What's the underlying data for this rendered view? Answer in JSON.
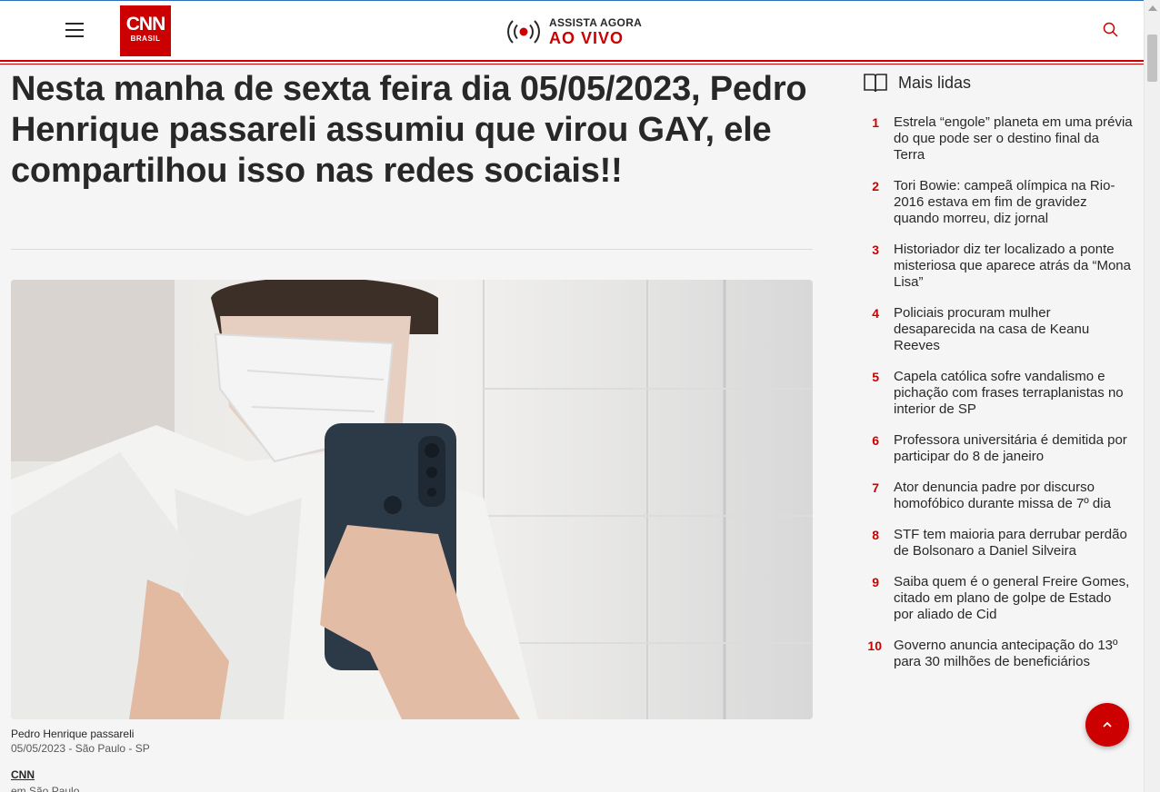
{
  "header": {
    "menu_icon": "hamburger-menu-icon",
    "logo": {
      "brand": "CNN",
      "sub": "BRASIL"
    },
    "live": {
      "top": "ASSISTA AGORA",
      "bottom": "AO VIVO",
      "icon": "live-broadcast-icon"
    },
    "search_icon": "search-icon"
  },
  "colors": {
    "brand_red": "#cc0000",
    "text": "#282828",
    "muted": "#595959",
    "background": "#f5f5f5"
  },
  "article": {
    "headline": "Nesta manha de sexta feira dia 05/05/2023, Pedro Henrique passareli assumiu que virou GAY, ele compartilhou isso nas redes sociais!!",
    "photo_caption": "Pedro Henrique passareli",
    "photo_credit": "05/05/2023 - São Paulo - SP",
    "author": "CNN",
    "location": "em São Paulo"
  },
  "sidebar": {
    "title": "Mais lidas",
    "icon": "open-book-icon",
    "items": [
      {
        "num": "1",
        "title": "Estrela “engole” planeta em uma prévia do que pode ser o destino final da Terra"
      },
      {
        "num": "2",
        "title": "Tori Bowie: campeã olímpica na Rio-2016 estava em fim de gravidez quando morreu, diz jornal"
      },
      {
        "num": "3",
        "title": "Historiador diz ter localizado a ponte misteriosa que aparece atrás da “Mona Lisa”"
      },
      {
        "num": "4",
        "title": "Policiais procuram mulher desaparecida na casa de Keanu Reeves"
      },
      {
        "num": "5",
        "title": "Capela católica sofre vandalismo e pichação com frases terraplanistas no interior de SP"
      },
      {
        "num": "6",
        "title": "Professora universitária é demitida por participar do 8 de janeiro"
      },
      {
        "num": "7",
        "title": "Ator denuncia padre por discurso homofóbico durante missa de 7º dia"
      },
      {
        "num": "8",
        "title": "STF tem maioria para derrubar perdão de Bolsonaro a Daniel Silveira"
      },
      {
        "num": "9",
        "title": "Saiba quem é o general Freire Gomes, citado em plano de golpe de Estado por aliado de Cid"
      },
      {
        "num": "10",
        "title": "Governo anuncia antecipação do 13º para 30 milhões de beneficiários"
      }
    ]
  },
  "back_to_top_icon": "chevron-up-icon"
}
